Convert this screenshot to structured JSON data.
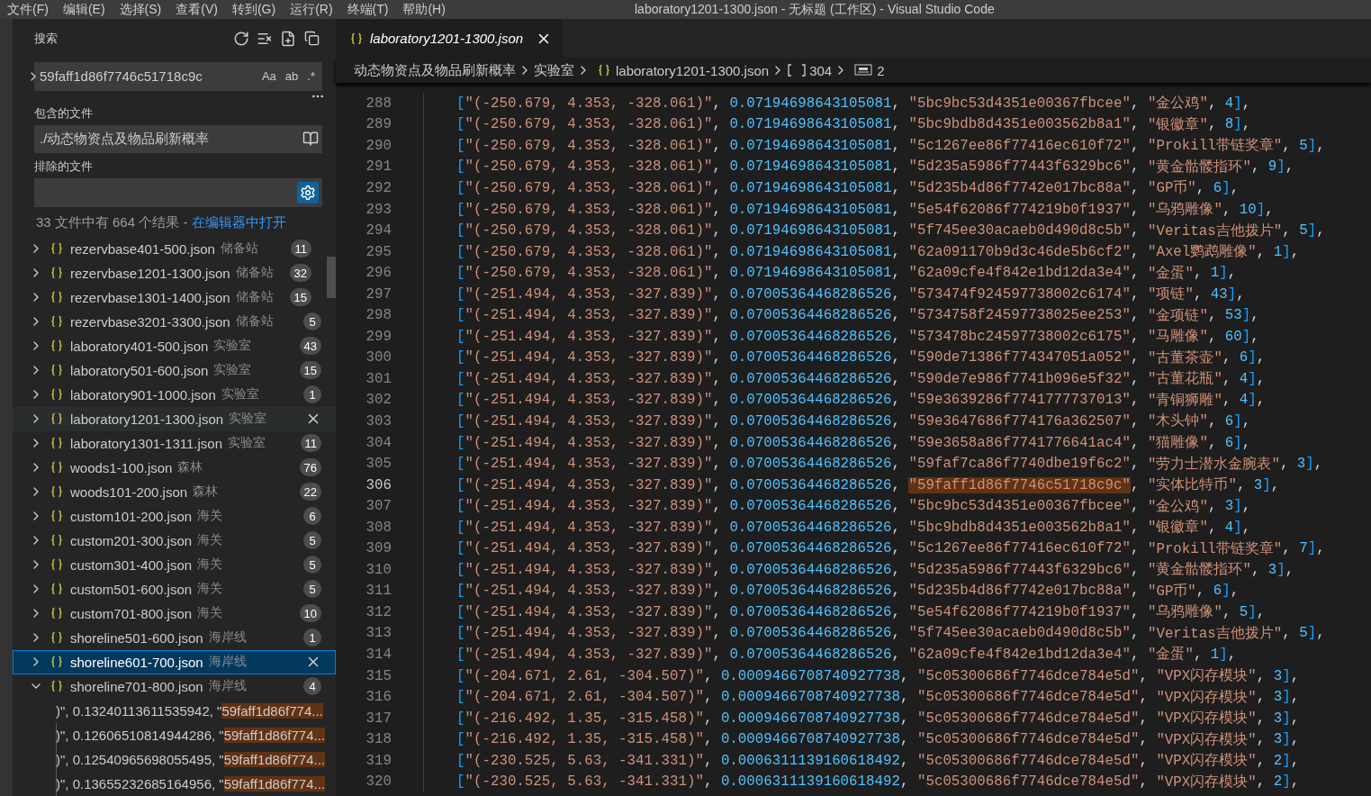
{
  "menu": [
    "文件(F)",
    "编辑(E)",
    "选择(S)",
    "查看(V)",
    "转到(G)",
    "运行(R)",
    "终端(T)",
    "帮助(H)"
  ],
  "window_title": "laboratory1201-1300.json - 无标题 (工作区) - Visual Studio Code",
  "sidebar": {
    "title": "搜索",
    "search": {
      "value": "59faff1d86f7746c51718c9c",
      "toggles": [
        {
          "label": "Aa",
          "on": false
        },
        {
          "label": "ab",
          "on": false
        },
        {
          "label": ".*",
          "on": false
        }
      ]
    },
    "include": {
      "label": "包含的文件",
      "value": "./动态物资点及物品刷新概率"
    },
    "exclude": {
      "label": "排除的文件",
      "use_settings": true
    },
    "summary": {
      "text": "33 文件中有 664 个结果 - ",
      "link": "在编辑器中打开"
    },
    "results": [
      {
        "file": "rezervbase401-500.json",
        "folder": "储备站",
        "count": "11",
        "hovered": false,
        "selected": false,
        "expanded": false
      },
      {
        "file": "rezervbase1201-1300.json",
        "folder": "储备站",
        "count": "32",
        "hovered": false,
        "selected": false,
        "expanded": false
      },
      {
        "file": "rezervbase1301-1400.json",
        "folder": "储备站",
        "count": "15",
        "hovered": false,
        "selected": false,
        "expanded": false
      },
      {
        "file": "rezervbase3201-3300.json",
        "folder": "储备站",
        "count": "5",
        "hovered": false,
        "selected": false,
        "expanded": false
      },
      {
        "file": "laboratory401-500.json",
        "folder": "实验室",
        "count": "43",
        "hovered": false,
        "selected": false,
        "expanded": false
      },
      {
        "file": "laboratory501-600.json",
        "folder": "实验室",
        "count": "15",
        "hovered": false,
        "selected": false,
        "expanded": false
      },
      {
        "file": "laboratory901-1000.json",
        "folder": "实验室",
        "count": "1",
        "hovered": false,
        "selected": false,
        "expanded": false
      },
      {
        "file": "laboratory1201-1300.json",
        "folder": "实验室",
        "hovered": true,
        "selected": false,
        "expanded": false
      },
      {
        "file": "laboratory1301-1311.json",
        "folder": "实验室",
        "count": "11",
        "hovered": false,
        "selected": false,
        "expanded": false
      },
      {
        "file": "woods1-100.json",
        "folder": "森林",
        "count": "76",
        "hovered": false,
        "selected": false,
        "expanded": false
      },
      {
        "file": "woods101-200.json",
        "folder": "森林",
        "count": "22",
        "hovered": false,
        "selected": false,
        "expanded": false
      },
      {
        "file": "custom101-200.json",
        "folder": "海关",
        "count": "6",
        "hovered": false,
        "selected": false,
        "expanded": false
      },
      {
        "file": "custom201-300.json",
        "folder": "海关",
        "count": "5",
        "hovered": false,
        "selected": false,
        "expanded": false
      },
      {
        "file": "custom301-400.json",
        "folder": "海关",
        "count": "5",
        "hovered": false,
        "selected": false,
        "expanded": false
      },
      {
        "file": "custom501-600.json",
        "folder": "海关",
        "count": "5",
        "hovered": false,
        "selected": false,
        "expanded": false
      },
      {
        "file": "custom701-800.json",
        "folder": "海关",
        "count": "10",
        "hovered": false,
        "selected": false,
        "expanded": false
      },
      {
        "file": "shoreline501-600.json",
        "folder": "海岸线",
        "count": "1",
        "hovered": false,
        "selected": false,
        "expanded": false
      },
      {
        "file": "shoreline601-700.json",
        "folder": "海岸线",
        "hovered": false,
        "selected": true,
        "expanded": false
      },
      {
        "file": "shoreline701-800.json",
        "folder": "海岸线",
        "count": "4",
        "hovered": false,
        "selected": false,
        "expanded": true,
        "children": [
          {
            "prefix": ")\", 0.13240113611535942, \"",
            "match": "59faff1d86f774..."
          },
          {
            "prefix": ")\", 0.12606510814944286, \"",
            "match": "59faff1d86f774..."
          },
          {
            "prefix": ")\", 0.12540965698055495, \"",
            "match": "59faff1d86f774..."
          },
          {
            "prefix": ")\", 0.13655232685164956, \"",
            "match": "59faff1d86f774..."
          }
        ]
      }
    ]
  },
  "editor": {
    "tab": {
      "title": "laboratory1201-1300.json",
      "selected": true
    },
    "breadcrumbs": [
      {
        "kind": "folder",
        "label": "动态物资点及物品刷新概率"
      },
      {
        "kind": "folder",
        "label": "实验室"
      },
      {
        "kind": "file",
        "label": "laboratory1201-1300.json"
      },
      {
        "kind": "array",
        "label": "304"
      },
      {
        "kind": "string",
        "label": "2"
      }
    ],
    "lines": [
      {
        "number": "288",
        "text": "[\"(-250.679, 4.353, -328.061)\", 0.07194698643105081, \"5bc9bc53d4351e00367fbcee\", \"金公鸡\", 4],",
        "current": false,
        "match": false
      },
      {
        "number": "289",
        "text": "[\"(-250.679, 4.353, -328.061)\", 0.07194698643105081, \"5bc9bdb8d4351e003562b8a1\", \"银徽章\", 8],",
        "current": false,
        "match": false
      },
      {
        "number": "290",
        "text": "[\"(-250.679, 4.353, -328.061)\", 0.07194698643105081, \"5c1267ee86f77416ec610f72\", \"Prokill带链奖章\", 5],",
        "current": false,
        "match": false
      },
      {
        "number": "291",
        "text": "[\"(-250.679, 4.353, -328.061)\", 0.07194698643105081, \"5d235a5986f77443f6329bc6\", \"黄金骷髅指环\", 9],",
        "current": false,
        "match": false
      },
      {
        "number": "292",
        "text": "[\"(-250.679, 4.353, -328.061)\", 0.07194698643105081, \"5d235b4d86f7742e017bc88a\", \"GP币\", 6],",
        "current": false,
        "match": false
      },
      {
        "number": "293",
        "text": "[\"(-250.679, 4.353, -328.061)\", 0.07194698643105081, \"5e54f62086f774219b0f1937\", \"乌鸦雕像\", 10],",
        "current": false,
        "match": false
      },
      {
        "number": "294",
        "text": "[\"(-250.679, 4.353, -328.061)\", 0.07194698643105081, \"5f745ee30acaeb0d490d8c5b\", \"Veritas吉他拨片\", 5],",
        "current": false,
        "match": false
      },
      {
        "number": "295",
        "text": "[\"(-250.679, 4.353, -328.061)\", 0.07194698643105081, \"62a091170b9d3c46de5b6cf2\", \"Axel鹦鹉雕像\", 1],",
        "current": false,
        "match": false
      },
      {
        "number": "296",
        "text": "[\"(-250.679, 4.353, -328.061)\", 0.07194698643105081, \"62a09cfe4f842e1bd12da3e4\", \"金蛋\", 1],",
        "current": false,
        "match": false
      },
      {
        "number": "297",
        "text": "[\"(-251.494, 4.353, -327.839)\", 0.07005364468286526, \"573474f924597738002c6174\", \"项链\", 43],",
        "current": false,
        "match": false
      },
      {
        "number": "298",
        "text": "[\"(-251.494, 4.353, -327.839)\", 0.07005364468286526, \"5734758f24597738025ee253\", \"金项链\", 53],",
        "current": false,
        "match": false
      },
      {
        "number": "299",
        "text": "[\"(-251.494, 4.353, -327.839)\", 0.07005364468286526, \"573478bc24597738002c6175\", \"马雕像\", 60],",
        "current": false,
        "match": false
      },
      {
        "number": "300",
        "text": "[\"(-251.494, 4.353, -327.839)\", 0.07005364468286526, \"590de71386f774347051a052\", \"古董茶壶\", 6],",
        "current": false,
        "match": false
      },
      {
        "number": "301",
        "text": "[\"(-251.494, 4.353, -327.839)\", 0.07005364468286526, \"590de7e986f7741b096e5f32\", \"古董花瓶\", 4],",
        "current": false,
        "match": false
      },
      {
        "number": "302",
        "text": "[\"(-251.494, 4.353, -327.839)\", 0.07005364468286526, \"59e3639286f7741777737013\", \"青铜狮雕\", 4],",
        "current": false,
        "match": false
      },
      {
        "number": "303",
        "text": "[\"(-251.494, 4.353, -327.839)\", 0.07005364468286526, \"59e3647686f774176a362507\", \"木头钟\", 6],",
        "current": false,
        "match": false
      },
      {
        "number": "304",
        "text": "[\"(-251.494, 4.353, -327.839)\", 0.07005364468286526, \"59e3658a86f7741776641ac4\", \"猫雕像\", 6],",
        "current": false,
        "match": false
      },
      {
        "number": "305",
        "text": "[\"(-251.494, 4.353, -327.839)\", 0.07005364468286526, \"59faf7ca86f7740dbe19f6c2\", \"劳力士潜水金腕表\", 3],",
        "current": false,
        "match": false
      },
      {
        "number": "306",
        "text": "[\"(-251.494, 4.353, -327.839)\", 0.07005364468286526, \"59faff1d86f7746c51718c9c\", \"实体比特币\", 3],",
        "current": true,
        "match": true
      },
      {
        "number": "307",
        "text": "[\"(-251.494, 4.353, -327.839)\", 0.07005364468286526, \"5bc9bc53d4351e00367fbcee\", \"金公鸡\", 3],",
        "current": false,
        "match": false
      },
      {
        "number": "308",
        "text": "[\"(-251.494, 4.353, -327.839)\", 0.07005364468286526, \"5bc9bdb8d4351e003562b8a1\", \"银徽章\", 4],",
        "current": false,
        "match": false
      },
      {
        "number": "309",
        "text": "[\"(-251.494, 4.353, -327.839)\", 0.07005364468286526, \"5c1267ee86f77416ec610f72\", \"Prokill带链奖章\", 7],",
        "current": false,
        "match": false
      },
      {
        "number": "310",
        "text": "[\"(-251.494, 4.353, -327.839)\", 0.07005364468286526, \"5d235a5986f77443f6329bc6\", \"黄金骷髅指环\", 3],",
        "current": false,
        "match": false
      },
      {
        "number": "311",
        "text": "[\"(-251.494, 4.353, -327.839)\", 0.07005364468286526, \"5d235b4d86f7742e017bc88a\", \"GP币\", 6],",
        "current": false,
        "match": false
      },
      {
        "number": "312",
        "text": "[\"(-251.494, 4.353, -327.839)\", 0.07005364468286526, \"5e54f62086f774219b0f1937\", \"乌鸦雕像\", 5],",
        "current": false,
        "match": false
      },
      {
        "number": "313",
        "text": "[\"(-251.494, 4.353, -327.839)\", 0.07005364468286526, \"5f745ee30acaeb0d490d8c5b\", \"Veritas吉他拨片\", 5],",
        "current": false,
        "match": false
      },
      {
        "number": "314",
        "text": "[\"(-251.494, 4.353, -327.839)\", 0.07005364468286526, \"62a09cfe4f842e1bd12da3e4\", \"金蛋\", 1],",
        "current": false,
        "match": false
      },
      {
        "number": "315",
        "text": "[\"(-204.671, 2.61, -304.507)\", 0.0009466708740927738, \"5c05300686f7746dce784e5d\", \"VPX闪存模块\", 3],",
        "current": false,
        "match": false
      },
      {
        "number": "316",
        "text": "[\"(-204.671, 2.61, -304.507)\", 0.0009466708740927738, \"5c05300686f7746dce784e5d\", \"VPX闪存模块\", 3],",
        "current": false,
        "match": false
      },
      {
        "number": "317",
        "text": "[\"(-216.492, 1.35, -315.458)\", 0.0009466708740927738, \"5c05300686f7746dce784e5d\", \"VPX闪存模块\", 3],",
        "current": false,
        "match": false
      },
      {
        "number": "318",
        "text": "[\"(-216.492, 1.35, -315.458)\", 0.0009466708740927738, \"5c05300686f7746dce784e5d\", \"VPX闪存模块\", 3],",
        "current": false,
        "match": false
      },
      {
        "number": "319",
        "text": "[\"(-230.525, 5.63, -341.331)\", 0.0006311139160618492, \"5c05300686f7746dce784e5d\", \"VPX闪存模块\", 2],",
        "current": false,
        "match": false
      },
      {
        "number": "320",
        "text": "[\"(-230.525, 5.63, -341.331)\", 0.0006311139160618492, \"5c05300686f7746dce784e5d\", \"VPX闪存模块\", 2],",
        "current": false,
        "match": false
      }
    ]
  }
}
